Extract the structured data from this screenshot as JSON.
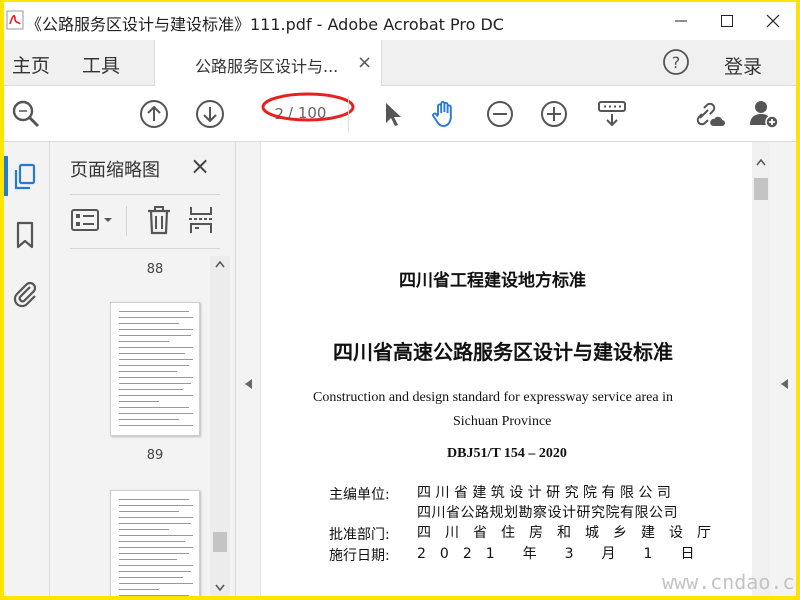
{
  "window": {
    "title": "《公路服务区设计与建设标准》111.pdf - Adobe Acrobat Pro DC"
  },
  "menu": {
    "home": "主页",
    "tools": "工具",
    "tab_label": "公路服务区设计与...",
    "tab_close": "×",
    "login": "登录"
  },
  "toolbar": {
    "current_page": "2",
    "total_pages": "/ 100",
    "icons": [
      "zoom-search-icon",
      "page-up-icon",
      "page-down-icon",
      "select-arrow-icon",
      "hand-icon",
      "zoom-out-icon",
      "zoom-in-icon",
      "fit-page-icon",
      "link-cloud-icon",
      "add-user-icon"
    ],
    "highlight_color": "#e82020",
    "accent_color": "#2679d4"
  },
  "thumbnails": {
    "title": "页面缩略图",
    "close": "×",
    "pages": [
      {
        "number": "88"
      },
      {
        "number": "89"
      }
    ]
  },
  "document": {
    "lines": {
      "header": "四川省工程建设地方标准",
      "title": "四川省高速公路服务区设计与建设标准",
      "en_title_1": "Construction and design standard for expressway service area in",
      "en_title_2": "Sichuan Province",
      "code": "DBJ51/T 154 – 2020",
      "editor_label": "主编单位:",
      "editor_1": "四 川 省 建 筑 设 计 研 究 院 有 限 公 司",
      "editor_2": "四川省公路规划勘察设计研究院有限公司",
      "approver_label": "批准部门:",
      "approver": "四　川　省　住　房　和　城　乡　建　设　厅",
      "date_label": "施行日期:",
      "date": "2　0　2　1　　年　　3　　月　　1　　日"
    }
  },
  "watermark": "www.cndao.com"
}
